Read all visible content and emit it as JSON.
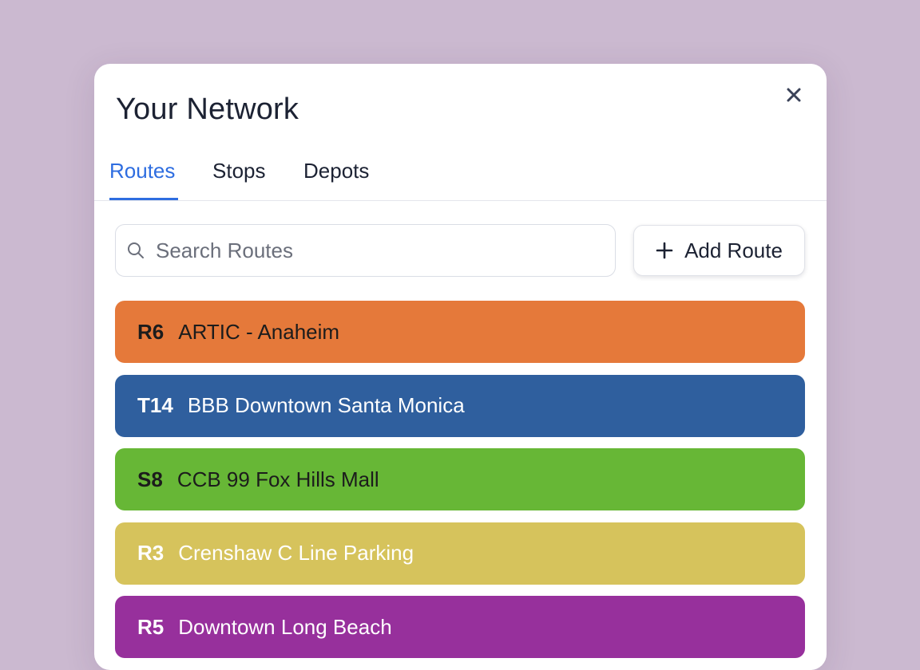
{
  "panel": {
    "title": "Your Network"
  },
  "tabs": [
    {
      "label": "Routes",
      "active": true
    },
    {
      "label": "Stops",
      "active": false
    },
    {
      "label": "Depots",
      "active": false
    }
  ],
  "search": {
    "placeholder": "Search Routes",
    "value": "",
    "icon": "search-icon"
  },
  "add_button": {
    "label": "Add Route",
    "icon": "plus-icon"
  },
  "close_icon": "close-icon",
  "routes": [
    {
      "code": "R6",
      "name": "ARTIC - Anaheim",
      "color": "#e5793a",
      "text_color": "#1c1c1c"
    },
    {
      "code": "T14",
      "name": "BBB Downtown Santa Monica",
      "color": "#2f5f9e",
      "text_color": "#ffffff"
    },
    {
      "code": "S8",
      "name": "CCB 99 Fox Hills Mall",
      "color": "#67b736",
      "text_color": "#1c1c1c"
    },
    {
      "code": "R3",
      "name": "Crenshaw C Line Parking",
      "color": "#d6c35c",
      "text_color": "#ffffff"
    },
    {
      "code": "R5",
      "name": "Downtown Long Beach",
      "color": "#97309c",
      "text_color": "#ffffff"
    }
  ],
  "colors": {
    "accent": "#2e6de0",
    "background": "#cbb9d0"
  }
}
